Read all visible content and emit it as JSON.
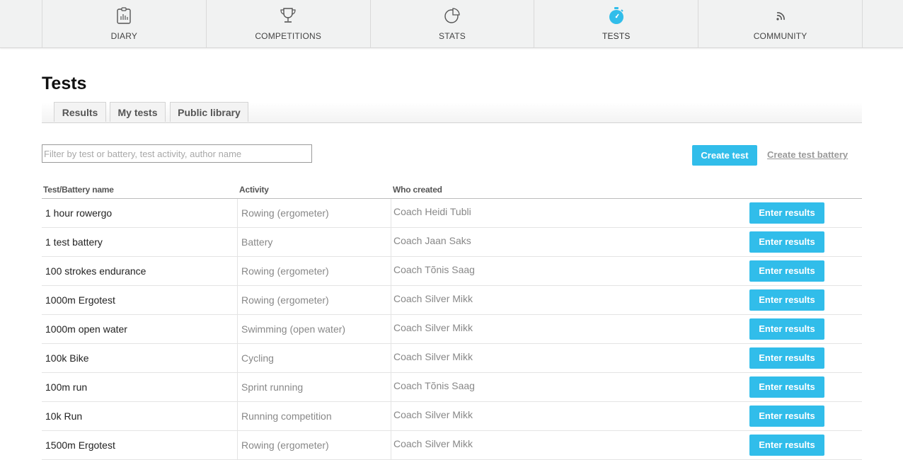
{
  "nav": {
    "items": [
      {
        "label": "DIARY",
        "icon": "diary-icon"
      },
      {
        "label": "COMPETITIONS",
        "icon": "trophy-icon"
      },
      {
        "label": "STATS",
        "icon": "pie-chart-icon"
      },
      {
        "label": "TESTS",
        "icon": "stopwatch-icon",
        "active": true
      },
      {
        "label": "COMMUNITY",
        "icon": "rss-icon"
      }
    ],
    "active_color": "#31bdea"
  },
  "page": {
    "title": "Tests"
  },
  "tabs": [
    {
      "label": "Results"
    },
    {
      "label": "My tests"
    },
    {
      "label": "Public library"
    }
  ],
  "toolbar": {
    "filter_placeholder": "Filter by test or battery, test activity, author name",
    "create_test_label": "Create test",
    "create_battery_label": "Create test battery"
  },
  "table": {
    "headers": {
      "name": "Test/Battery name",
      "activity": "Activity",
      "author": "Who created"
    },
    "action_label": "Enter results",
    "rows": [
      {
        "name": "1 hour rowergo",
        "activity": "Rowing (ergometer)",
        "author": "Coach Heidi Tubli"
      },
      {
        "name": "1 test battery",
        "activity": "Battery",
        "author": "Coach Jaan Saks"
      },
      {
        "name": "100 strokes endurance",
        "activity": "Rowing (ergometer)",
        "author": "Coach Tõnis Saag"
      },
      {
        "name": "1000m Ergotest",
        "activity": "Rowing (ergometer)",
        "author": "Coach Silver Mikk"
      },
      {
        "name": "1000m open water",
        "activity": "Swimming (open water)",
        "author": "Coach Silver Mikk"
      },
      {
        "name": "100k Bike",
        "activity": "Cycling",
        "author": "Coach Silver Mikk"
      },
      {
        "name": "100m run",
        "activity": "Sprint running",
        "author": "Coach Tõnis Saag"
      },
      {
        "name": "10k Run",
        "activity": "Running competition",
        "author": "Coach Silver Mikk"
      },
      {
        "name": "1500m Ergotest",
        "activity": "Rowing (ergometer)",
        "author": "Coach Silver Mikk"
      }
    ]
  },
  "colors": {
    "accent": "#31bdea",
    "nav_bg": "#f1f2f2"
  }
}
